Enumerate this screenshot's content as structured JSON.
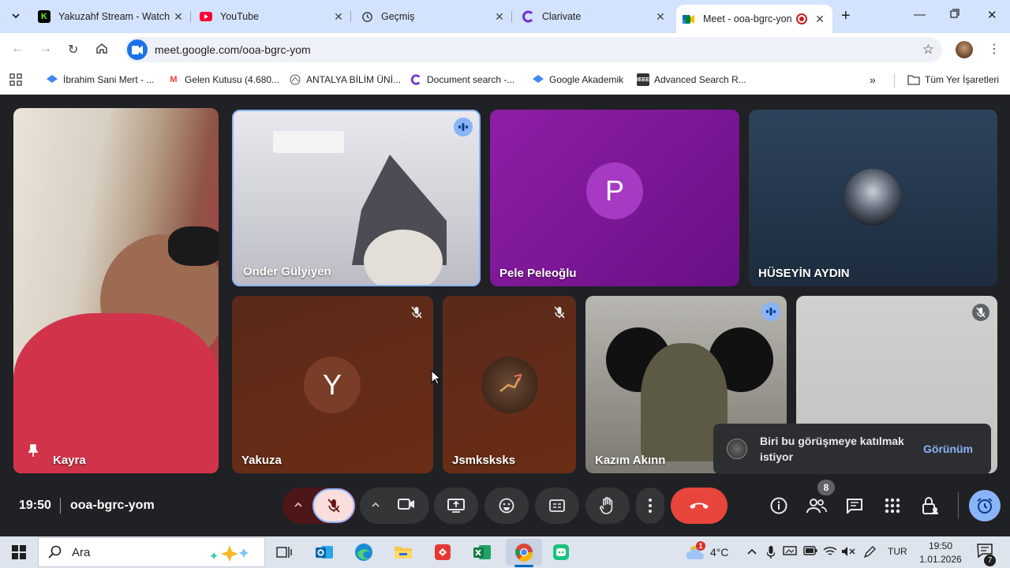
{
  "browser": {
    "tabs": [
      {
        "title": "Yakuzahf Stream - Watch",
        "favicon": "kick-icon"
      },
      {
        "title": "YouTube",
        "favicon": "youtube-icon"
      },
      {
        "title": "Geçmiş",
        "favicon": "history-icon"
      },
      {
        "title": "Clarivate",
        "favicon": "clarivate-icon"
      },
      {
        "title": "Meet - ooa-bgrc-yon",
        "favicon": "meet-icon",
        "active": true
      }
    ],
    "url": "meet.google.com/ooa-bgrc-yom",
    "bookmarks": [
      {
        "label": "İbrahim Sani Mert - ..."
      },
      {
        "label": "Gelen Kutusu (4.680..."
      },
      {
        "label": "ANTALYA BİLİM ÜNİ..."
      },
      {
        "label": "Document search -..."
      },
      {
        "label": "Google Akademik"
      },
      {
        "label": "Advanced Search R..."
      }
    ],
    "all_bookmarks_label": "Tüm Yer İşaretleri"
  },
  "meet": {
    "participants": [
      {
        "name": "Kayra"
      },
      {
        "name": "Önder Gülyiyen"
      },
      {
        "name": "Pele Peleoğlu",
        "initial": "P"
      },
      {
        "name": "HÜSEYİN AYDIN"
      },
      {
        "name": "Yakuza",
        "initial": "Y"
      },
      {
        "name": "Jsmksksks"
      },
      {
        "name": "Kazım Akınn"
      }
    ],
    "toast": {
      "message": "Biri bu görüşmeye katılmak istiyor",
      "action": "Görünüm"
    },
    "time": "19:50",
    "meeting_code": "ooa-bgrc-yom",
    "people_count": "8",
    "colors": {
      "end_call": "#e8453c",
      "accent": "#8ab4f8",
      "mic_off_bg": "#f9dedc"
    }
  },
  "taskbar": {
    "search_placeholder": "Ara",
    "weather": "4°C",
    "language": "TUR",
    "time": "19:50",
    "date": "1.01.2026",
    "notifications": "7",
    "weather_badge": "1"
  }
}
